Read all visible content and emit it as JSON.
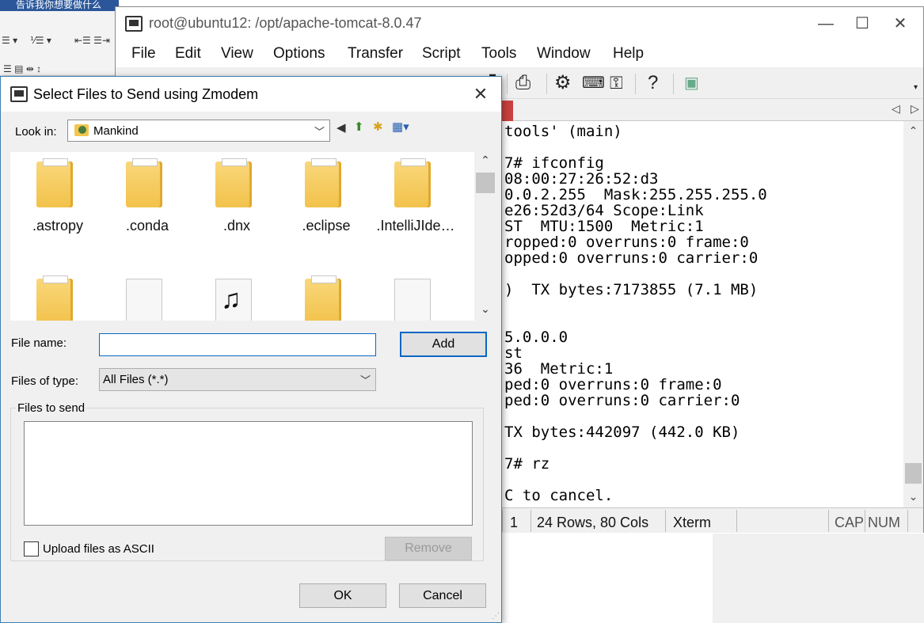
{
  "background_editor": {
    "title": "告诉我你想要做什么"
  },
  "crt": {
    "title": "root@ubuntu12: /opt/apache-tomcat-8.0.47",
    "menu": [
      "File",
      "Edit",
      "View",
      "Options",
      "Transfer",
      "Script",
      "Tools",
      "Window",
      "Help"
    ],
    "terminal_lines": [
      "tools' (main)",
      "",
      "7# ifconfig",
      "08:00:27:26:52:d3",
      "0.0.2.255  Mask:255.255.255.0",
      "e26:52d3/64 Scope:Link",
      "ST  MTU:1500  Metric:1",
      "ropped:0 overruns:0 frame:0",
      "opped:0 overruns:0 carrier:0",
      "",
      ")  TX bytes:7173855 (7.1 MB)",
      "",
      "",
      "5.0.0.0",
      "st",
      "36  Metric:1",
      "ped:0 overruns:0 frame:0",
      "ped:0 overruns:0 carrier:0",
      "",
      "TX bytes:442097 (442.0 KB)",
      "",
      "7# rz",
      "",
      "C to cancel."
    ],
    "status": {
      "line": "1",
      "size": "24 Rows, 80 Cols",
      "emulation": "Xterm",
      "cap": "CAP",
      "num": "NUM"
    }
  },
  "dialog": {
    "title": "Select Files to Send using Zmodem",
    "look_in_label": "Look in:",
    "look_in_value": "Mankind",
    "files": [
      {
        "name": ".astropy",
        "kind": "folder"
      },
      {
        "name": ".conda",
        "kind": "folder"
      },
      {
        "name": ".dnx",
        "kind": "folder"
      },
      {
        "name": ".eclipse",
        "kind": "folder"
      },
      {
        "name": ".IntelliJIde…",
        "kind": "folder"
      },
      {
        "name": "",
        "kind": "folder"
      },
      {
        "name": "",
        "kind": "file"
      },
      {
        "name": "",
        "kind": "music"
      },
      {
        "name": "",
        "kind": "folder"
      },
      {
        "name": "",
        "kind": "file"
      }
    ],
    "file_name_label": "File name:",
    "file_name_value": "",
    "add_label": "Add",
    "files_of_type_label": "Files of type:",
    "files_of_type_value": "All Files (*.*)",
    "files_to_send_label": "Files to send",
    "upload_ascii_label": "Upload files as ASCII",
    "remove_label": "Remove",
    "ok_label": "OK",
    "cancel_label": "Cancel"
  }
}
